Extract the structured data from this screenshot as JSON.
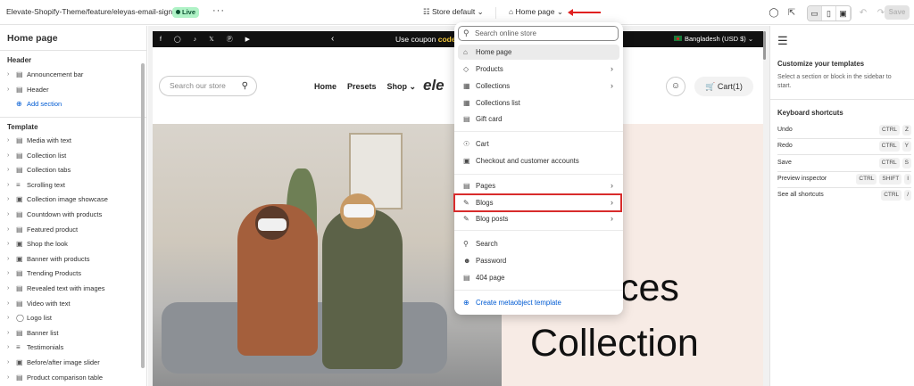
{
  "topbar": {
    "theme_name": "Elevate-Shopify-Theme/feature/eleyas-email-signup",
    "live_badge": "Live",
    "more": "···",
    "store_selector": "Store default",
    "page_selector": "Home page",
    "save_label": "Save"
  },
  "sidebar": {
    "title": "Home page",
    "header_label": "Header",
    "header_items": [
      "Announcement bar",
      "Header"
    ],
    "add_section": "Add section",
    "template_label": "Template",
    "template_items": [
      "Media with text",
      "Collection list",
      "Collection tabs",
      "Scrolling text",
      "Collection image showcase",
      "Countdown with products",
      "Featured product",
      "Shop the look",
      "Banner with products",
      "Trending Products",
      "Revealed text with images",
      "Video with text",
      "Logo list",
      "Banner list",
      "Testimonials",
      "Before/after image slider",
      "Product comparison table"
    ]
  },
  "preview": {
    "coupon_text": "Use coupon",
    "coupon_code": "code",
    "country": "Bangladesh (USD $)",
    "search_placeholder": "Search our store",
    "nav": [
      "Home",
      "Presets",
      "Shop"
    ],
    "logo": "ele",
    "cart": "Cart(1)",
    "hero_line1": "ces",
    "hero_line2": "Collection"
  },
  "dropdown": {
    "search_placeholder": "Search online store",
    "items": [
      {
        "label": "Home page",
        "icon": "home-icon"
      },
      {
        "label": "Products",
        "icon": "tag-icon"
      },
      {
        "label": "Collections",
        "icon": "collection-icon"
      },
      {
        "label": "Collections list",
        "icon": "collection-icon"
      },
      {
        "label": "Gift card",
        "icon": "gift-card-icon"
      },
      {
        "label": "Cart",
        "icon": "cart-icon"
      },
      {
        "label": "Checkout and customer accounts",
        "icon": "checkout-icon"
      },
      {
        "label": "Pages",
        "icon": "page-icon"
      },
      {
        "label": "Blogs",
        "icon": "blog-icon"
      },
      {
        "label": "Blog posts",
        "icon": "blog-icon"
      },
      {
        "label": "Search",
        "icon": "search-icon"
      },
      {
        "label": "Password",
        "icon": "lock-icon"
      },
      {
        "label": "404 page",
        "icon": "page-icon"
      },
      {
        "label": "Create metaobject template",
        "icon": "plus-circle-icon"
      }
    ]
  },
  "right_panel": {
    "title": "Customize your templates",
    "subtitle": "Select a section or block in the sidebar to start.",
    "shortcuts_title": "Keyboard shortcuts",
    "shortcuts": [
      {
        "label": "Undo",
        "keys": [
          "CTRL",
          "Z"
        ]
      },
      {
        "label": "Redo",
        "keys": [
          "CTRL",
          "Y"
        ]
      },
      {
        "label": "Save",
        "keys": [
          "CTRL",
          "S"
        ]
      },
      {
        "label": "Preview inspector",
        "keys": [
          "CTRL",
          "SHIFT",
          "I"
        ]
      },
      {
        "label": "See all shortcuts",
        "keys": [
          "CTRL",
          "/"
        ]
      }
    ]
  },
  "colors": {
    "accent_blue": "#005bd3",
    "highlight_red": "#d82c2c",
    "live_green": "#aff2c6"
  }
}
